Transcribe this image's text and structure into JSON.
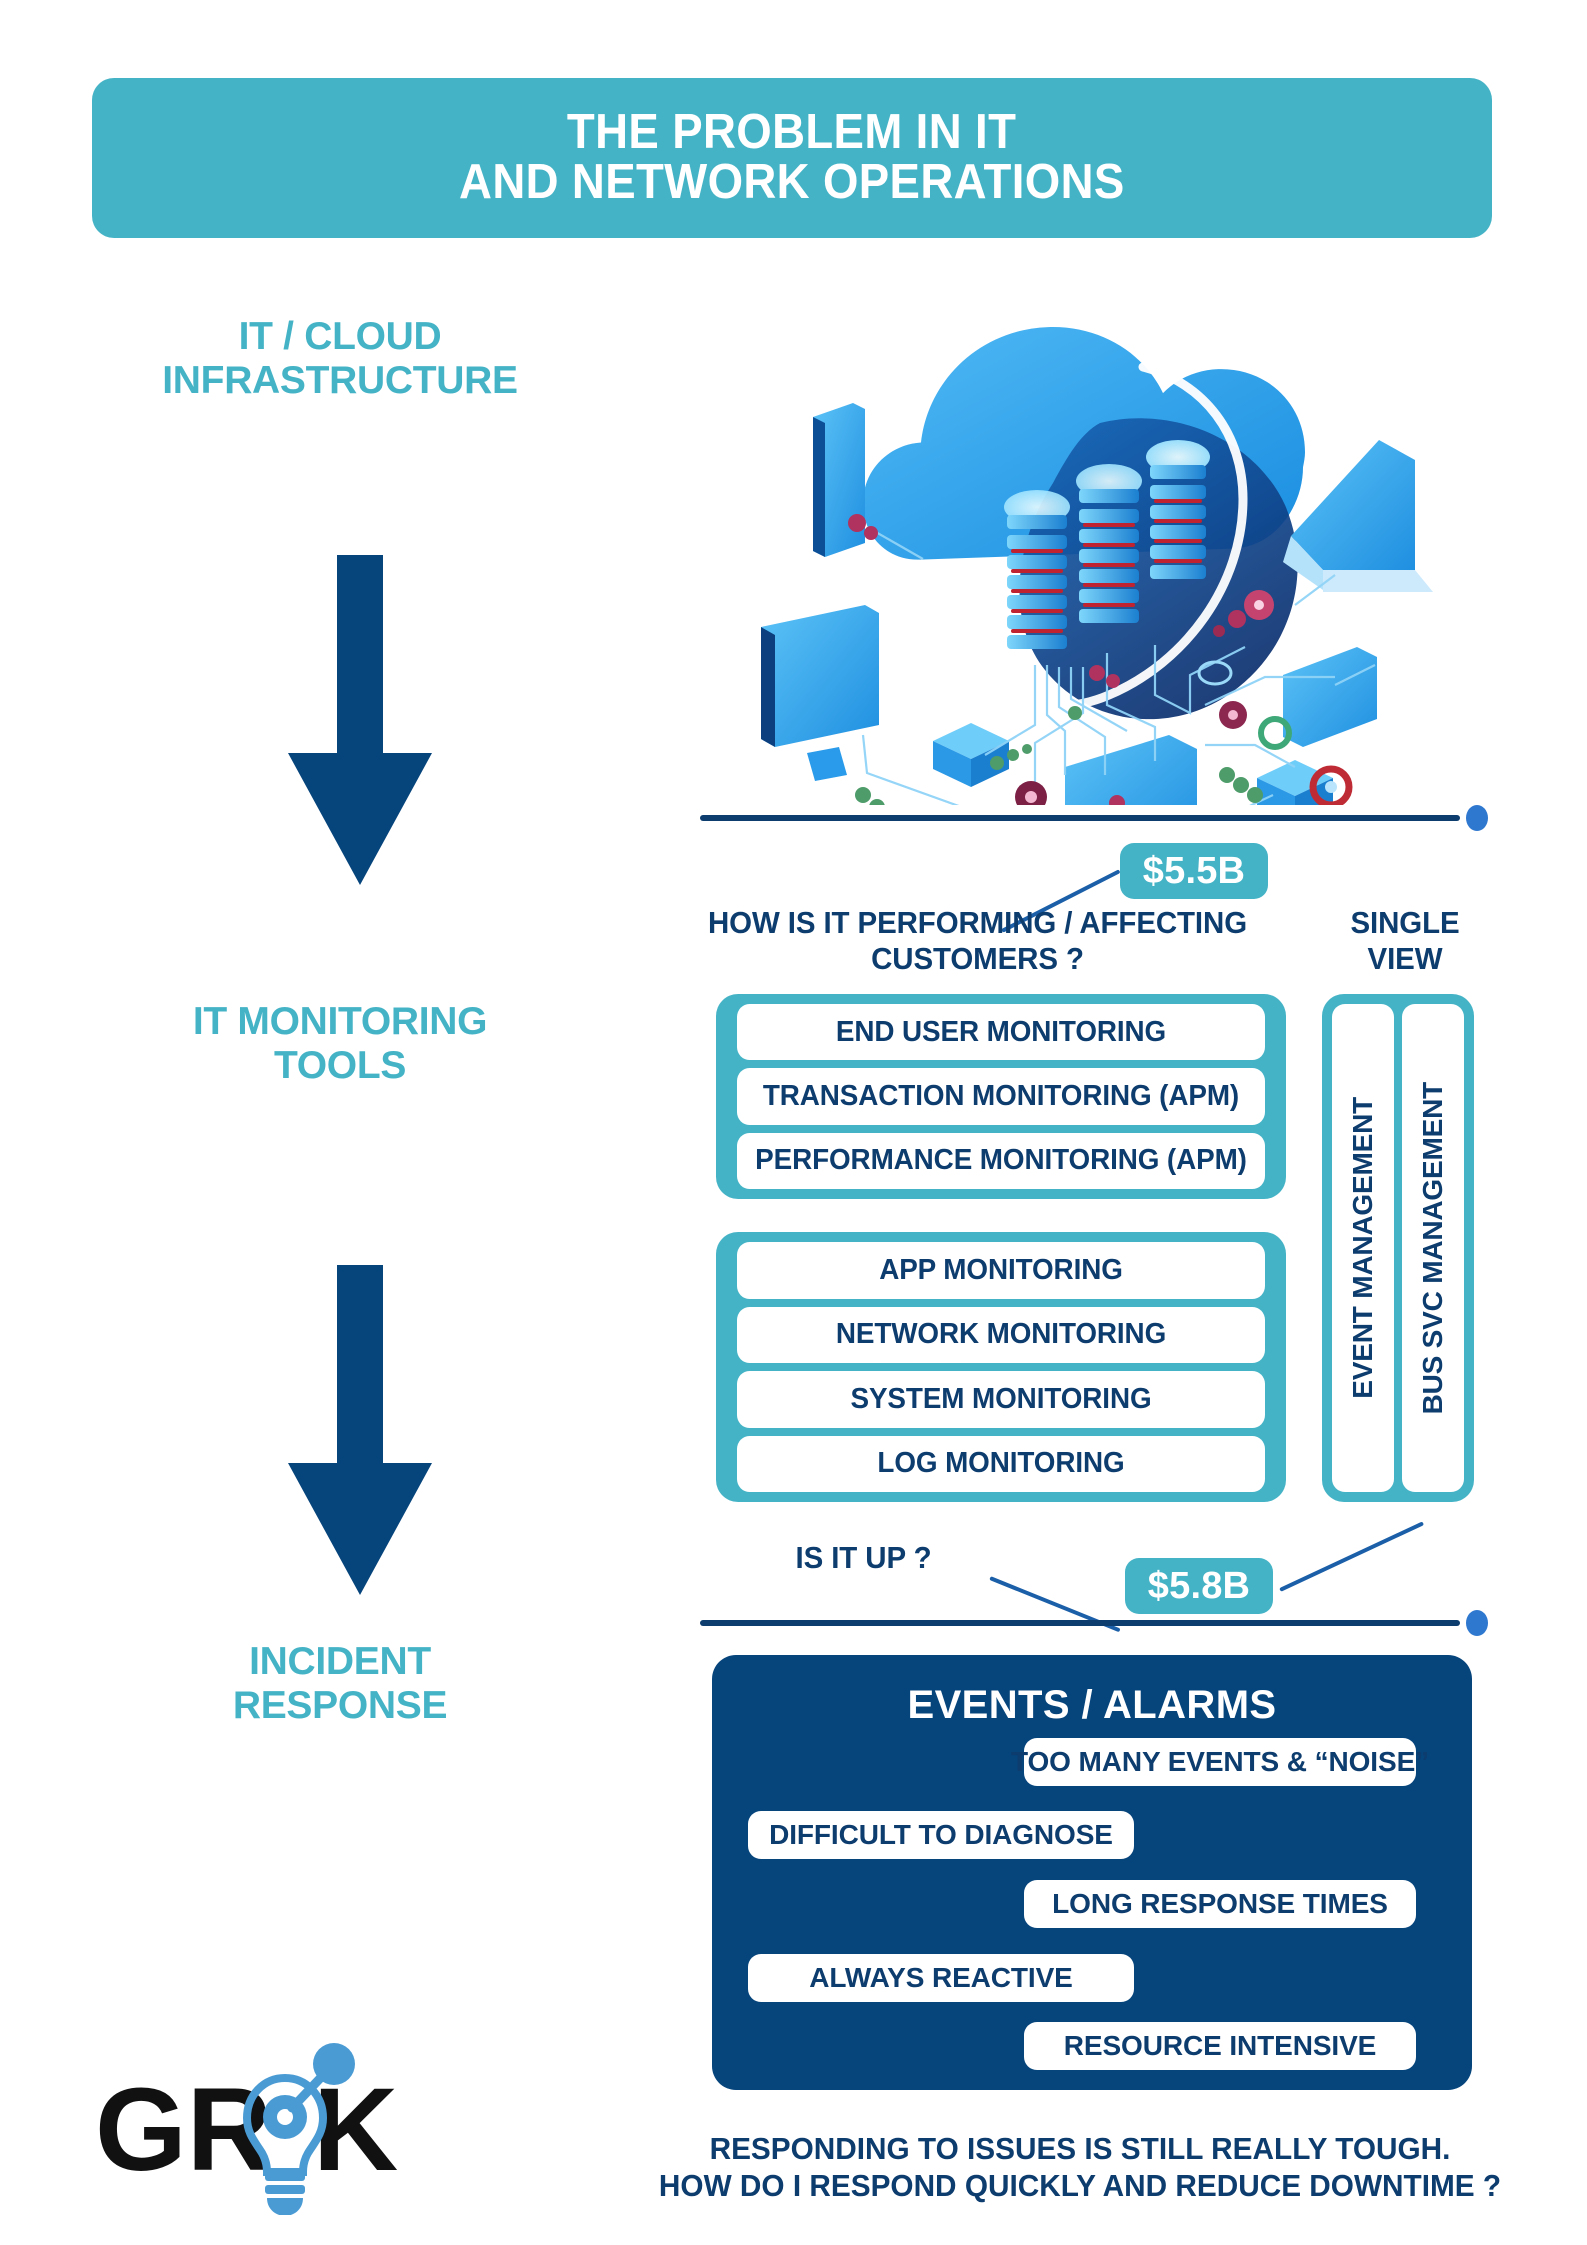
{
  "header": {
    "line1": "THE PROBLEM IN IT",
    "line2": "AND NETWORK OPERATIONS",
    "background_color": "#45b3c6"
  },
  "colors": {
    "teal": "#45b3c6",
    "navy": "#06447c",
    "navy_text": "#0d3c6e",
    "line_blue": "#1b5fa8",
    "dot_blue": "#2f78cf",
    "white": "#ffffff"
  },
  "stages": [
    {
      "id": "infrastructure",
      "label_line1": "IT / CLOUD",
      "label_line2": "INFRASTRUCTURE"
    },
    {
      "id": "monitoring",
      "label_line1": "IT MONITORING",
      "label_line2": "TOOLS"
    },
    {
      "id": "incident",
      "label_line1": "INCIDENT",
      "label_line2": "RESPONSE"
    }
  ],
  "monitoring": {
    "question_performing_line1": "HOW IS IT PERFORMING / AFFECTING",
    "question_performing_line2": "CUSTOMERS ?",
    "question_single_view_line1": "SINGLE",
    "question_single_view_line2": "VIEW",
    "question_is_it_up": "IS IT UP ?",
    "badge_top": "$5.5B",
    "badge_bottom": "$5.8B",
    "group_performance": [
      "END USER MONITORING",
      "TRANSACTION MONITORING (APM)",
      "PERFORMANCE MONITORING (APM)"
    ],
    "group_infrastructure": [
      "APP MONITORING",
      "NETWORK MONITORING",
      "SYSTEM MONITORING",
      "LOG MONITORING"
    ],
    "single_view_columns": [
      "EVENT MANAGEMENT",
      "BUS SVC MANAGEMENT"
    ]
  },
  "events": {
    "title": "EVENTS / ALARMS",
    "pills": [
      "TOO MANY EVENTS & “NOISE”",
      "DIFFICULT TO DIAGNOSE",
      "LONG RESPONSE TIMES",
      "ALWAYS REACTIVE",
      "RESOURCE INTENSIVE"
    ]
  },
  "caption": {
    "line1": "RESPONDING TO ISSUES IS STILL REALLY TOUGH.",
    "line2": "HOW DO I RESPOND QUICKLY AND REDUCE DOWNTIME ?"
  },
  "logo": {
    "text_before": "GR",
    "text_after": "K",
    "icon": "lightbulb-icon"
  }
}
